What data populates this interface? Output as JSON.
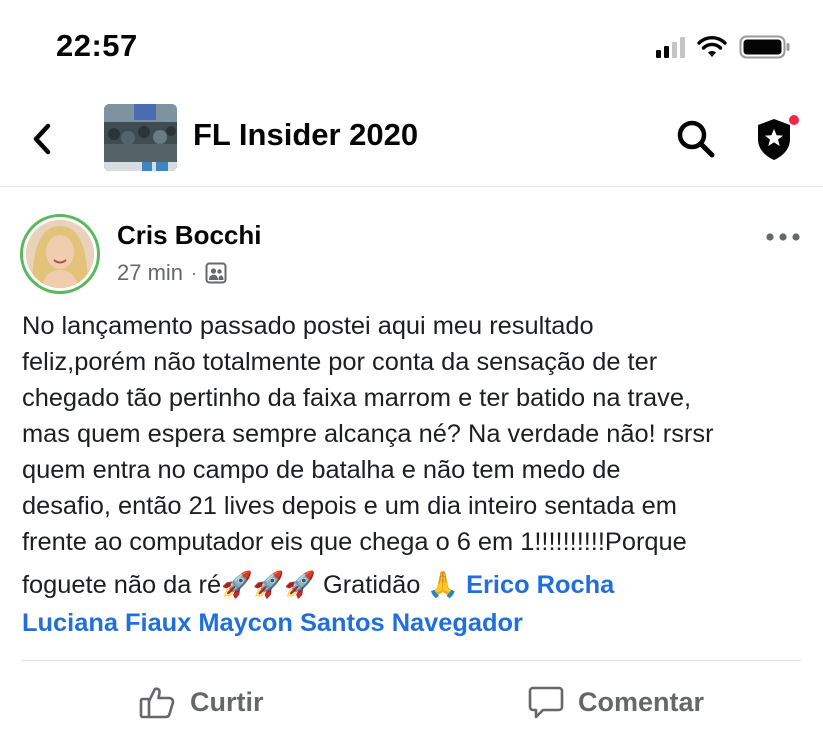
{
  "status_bar": {
    "time": "22:57"
  },
  "header": {
    "group_title": "FL Insider 2020",
    "icons": [
      "back-arrow-icon",
      "search-icon",
      "admin-shield-star-icon"
    ],
    "notification_dot_color": "#f02849"
  },
  "post": {
    "author_name": "Cris Bocchi",
    "time_ago": "27 min",
    "meta_separator": "·",
    "privacy_icon": "group-members-icon",
    "text_lines": [
      "No lançamento passado postei aqui meu resultado",
      "feliz,porém não totalmente por conta da sensação de ter",
      "chegado tão pertinho da faixa marrom e ter batido na trave,",
      "mas quem espera sempre alcança né? Na verdade não! rsrsr",
      "quem entra no campo de batalha e não tem medo de",
      "desafio, então 21 lives depois e um dia inteiro sentada em",
      "frente ao computador eis que chega o 6 em 1!!!!!!!!!!Porque"
    ],
    "last_line_text": "foguete não da ré",
    "rocket_emojis": "🚀🚀🚀",
    "gratitude_text": "Gratidão",
    "pray_emoji": "🙏",
    "mentions": [
      "Erico Rocha",
      "Luciana Fiaux",
      "Maycon Santos",
      "Navegador"
    ],
    "mention_color": "#216fdb",
    "avatar_ring_color": "#5cb85c"
  },
  "actions": {
    "like_label": "Curtir",
    "comment_label": "Comentar"
  }
}
